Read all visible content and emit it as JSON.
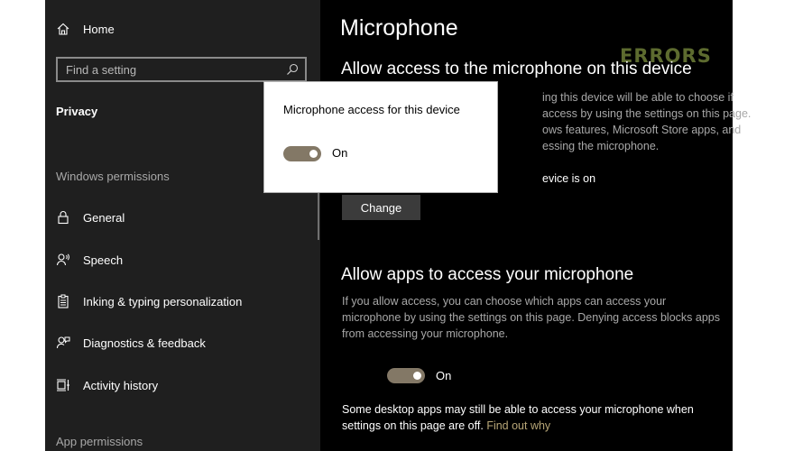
{
  "sidebar": {
    "home_label": "Home",
    "search_placeholder": "Find a setting",
    "current_section": "Privacy",
    "windows_permissions_heading": "Windows permissions",
    "items": [
      {
        "label": "General",
        "icon": "lock-icon"
      },
      {
        "label": "Speech",
        "icon": "speech-icon"
      },
      {
        "label": "Inking & typing personalization",
        "icon": "clipboard-icon"
      },
      {
        "label": "Diagnostics & feedback",
        "icon": "feedback-icon"
      },
      {
        "label": "Activity history",
        "icon": "timeline-icon"
      }
    ],
    "app_permissions_heading": "App permissions"
  },
  "main": {
    "title": "Microphone",
    "watermark": "ERRORS",
    "device_section": {
      "heading": "Allow access to the microphone on this device",
      "description_lines": [
        "ing this device will be able to choose if",
        "access by using the settings on this page.",
        "ows features, Microsoft Store apps, and",
        "essing the microphone."
      ],
      "status": "evice is on",
      "change_button": "Change"
    },
    "apps_section": {
      "heading": "Allow apps to access your microphone",
      "description": "If you allow access, you can choose which apps can access your microphone by using the settings on this page. Denying access blocks apps from accessing your microphone.",
      "toggle_state": "On",
      "note": "Some desktop apps may still be able to access your microphone when settings on this page are off.",
      "note_link": "Find out why"
    }
  },
  "popup": {
    "title": "Microphone access for this device",
    "toggle_state": "On"
  },
  "colors": {
    "sidebar_bg": "#1f1f1f",
    "main_bg": "#000000",
    "toggle_on": "#837866",
    "link": "#b7a677",
    "watermark": "#5d6b2f"
  }
}
